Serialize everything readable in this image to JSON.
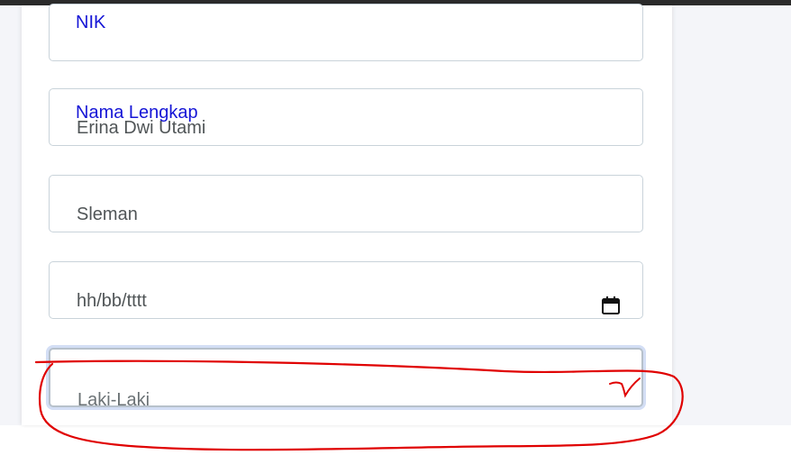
{
  "form": {
    "nik": {
      "label": "NIK",
      "value": ""
    },
    "nama_lengkap": {
      "label": "Nama Lengkap",
      "value": "Erina Dwi Utami"
    },
    "tempat_lahir": {
      "value": "Sleman"
    },
    "tanggal_lahir": {
      "placeholder": "hh/bb/tttt",
      "icon": "calendar-icon"
    },
    "jenis_kelamin": {
      "selected": "Laki-Laki",
      "icon": "chevron-down-icon"
    }
  },
  "colors": {
    "label": "#1515d6",
    "value_text": "#505557",
    "annotation": "#e00000",
    "field_border": "#c9d3da"
  }
}
